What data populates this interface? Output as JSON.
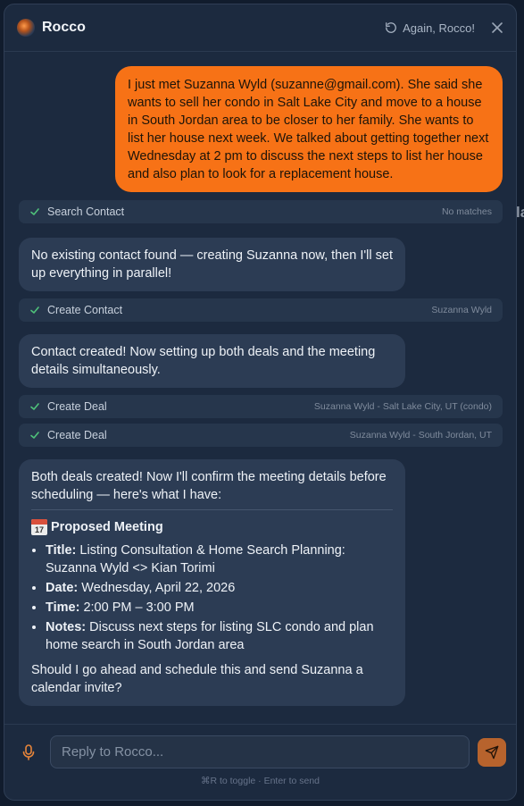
{
  "app": {
    "title": "Rocco"
  },
  "header": {
    "again_label": "Again, Rocco!"
  },
  "messages": {
    "user_1": "I just met Suzanna Wyld (suzanne@gmail.com). She said she wants to sell her condo in Salt Lake City and move to a house in South Jordan area to be closer to her family. She wants to list her house next week. We talked about getting together next Wednesday at 2 pm to discuss the next steps to list her house and also plan to look for a replacement house.",
    "tool_1": {
      "label": "Search Contact",
      "meta": "No matches"
    },
    "bot_1": "No existing contact found — creating Suzanna now, then I'll set up everything in parallel!",
    "tool_2": {
      "label": "Create Contact",
      "meta": "Suzanna Wyld"
    },
    "bot_2": "Contact created! Now setting up both deals and the meeting details simultaneously.",
    "tool_3": {
      "label": "Create Deal",
      "meta": "Suzanna Wyld - Salt Lake City, UT (condo)"
    },
    "tool_4": {
      "label": "Create Deal",
      "meta": "Suzanna Wyld - South Jordan, UT"
    },
    "bot_3": {
      "intro": "Both deals created! Now I'll confirm the meeting details before scheduling — here's what I have:",
      "calendar_day": "17",
      "meeting_heading": "Proposed Meeting",
      "title_label": "Title:",
      "title_value": "Listing Consultation & Home Search Planning: Suzanna Wyld <> Kian Torimi",
      "date_label": "Date:",
      "date_value": "Wednesday, April 22, 2026",
      "time_label": "Time:",
      "time_value": "2:00 PM – 3:00 PM",
      "notes_label": "Notes:",
      "notes_value": "Discuss next steps for listing SLC condo and plan home search in South Jordan area",
      "question": "Should I go ahead and schedule this and send Suzanna a calendar invite?"
    }
  },
  "composer": {
    "placeholder": "Reply to Rocco...",
    "hint": "⌘R to toggle · Enter to send"
  },
  "colors": {
    "accent": "#f77216",
    "panel": "#1c2a3f",
    "bot_bubble": "#2c3c54",
    "success": "#4fc27a"
  },
  "icons": [
    "refresh-icon",
    "close-icon",
    "check-icon",
    "calendar-icon",
    "mic-icon",
    "send-icon"
  ]
}
